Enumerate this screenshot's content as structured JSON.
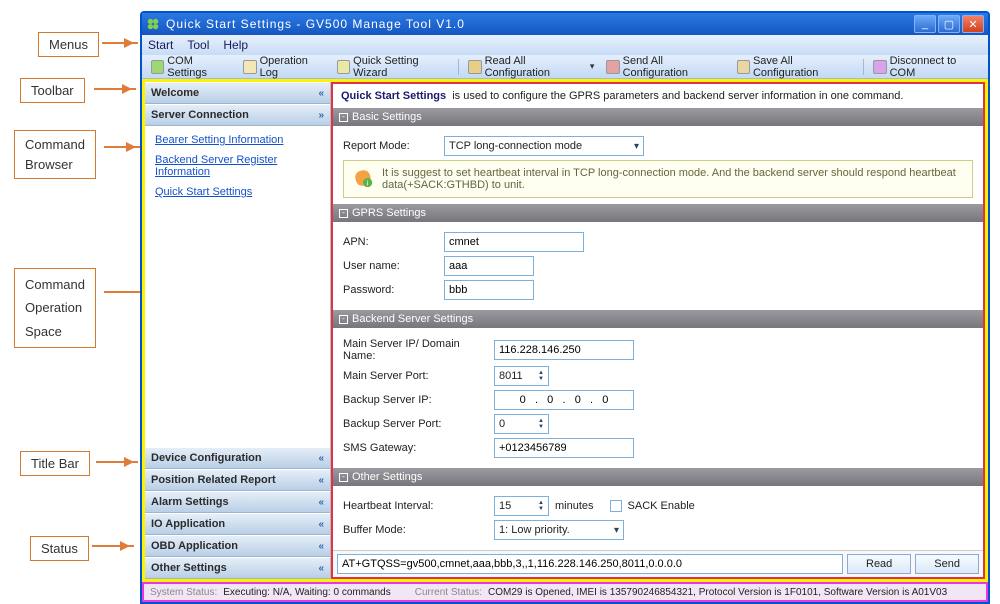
{
  "labels": {
    "menus": "Menus",
    "toolbar": "Toolbar",
    "command_browser_l1": "Command",
    "command_browser_l2": "Browser",
    "command_op_l1": "Command",
    "command_op_l2": "Operation",
    "command_op_l3": "Space",
    "titlebar": "Title Bar",
    "status": "Status"
  },
  "title": "Quick Start Settings - GV500 Manage Tool V1.0",
  "menus": [
    "Start",
    "Tool",
    "Help"
  ],
  "toolbar": {
    "com_settings": "COM Settings",
    "operation_log": "Operation Log",
    "quick_wizard": "Quick Setting Wizard",
    "read_all": "Read All Configuration",
    "send_all": "Send All Configuration",
    "save_all": "Save All Configuration",
    "disconnect": "Disconnect to COM"
  },
  "sidebar": {
    "welcome": "Welcome",
    "server_conn": "Server Connection",
    "links": {
      "bearer": "Bearer Setting Information",
      "backend": "Backend Server Register Information",
      "quick": "Quick Start Settings"
    },
    "device_config": "Device Configuration",
    "position_report": "Position Related Report",
    "alarm": "Alarm Settings",
    "io_app": "IO Application",
    "obd_app": "OBD Application",
    "other": "Other Settings"
  },
  "main": {
    "desc_title": "Quick Start Settings",
    "desc_text": "is used to configure the GPRS parameters and backend server information in one command.",
    "basic": {
      "title": "Basic Settings",
      "report_mode_lbl": "Report Mode:",
      "report_mode_val": "TCP long-connection mode",
      "hint": "It is suggest to set heartbeat interval in TCP long-connection mode. And the backend server should respond heartbeat data(+SACK:GTHBD) to unit."
    },
    "gprs": {
      "title": "GPRS Settings",
      "apn_lbl": "APN:",
      "apn_val": "cmnet",
      "user_lbl": "User name:",
      "user_val": "aaa",
      "pass_lbl": "Password:",
      "pass_val": "bbb"
    },
    "backend": {
      "title": "Backend Server Settings",
      "main_ip_lbl": "Main Server IP/ Domain Name:",
      "main_ip_val": "116.228.146.250",
      "main_port_lbl": "Main Server Port:",
      "main_port_val": "8011",
      "backup_ip_lbl": "Backup Server IP:",
      "backup_ip_val": "0   .   0   .   0   .   0",
      "backup_port_lbl": "Backup Server Port:",
      "backup_port_val": "0",
      "sms_lbl": "SMS Gateway:",
      "sms_val": "+0123456789"
    },
    "other": {
      "title": "Other Settings",
      "heartbeat_lbl": "Heartbeat Interval:",
      "heartbeat_val": "15",
      "heartbeat_unit": "minutes",
      "sack_lbl": "SACK Enable",
      "buffer_lbl": "Buffer Mode:",
      "buffer_val": "1: Low priority."
    },
    "cmd_text": "AT+GTQSS=gv500,cmnet,aaa,bbb,3,,1,116.228.146.250,8011,0.0.0.0",
    "read_btn": "Read",
    "send_btn": "Send"
  },
  "status": {
    "sys_label": "System Status:",
    "sys_val": "Executing: N/A, Waiting: 0 commands",
    "cur_label": "Current Status:",
    "cur_val": "COM29 is Opened, IMEI is 135790246854321, Protocol Version is 1F0101, Software Version is A01V03"
  }
}
